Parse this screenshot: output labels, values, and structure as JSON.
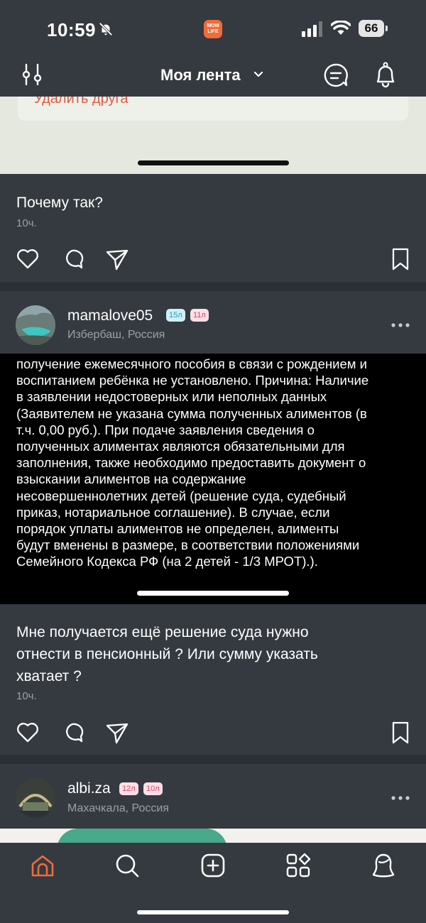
{
  "status_bar": {
    "time": "10:59",
    "app_badge": "MOM LIFE",
    "battery": "66"
  },
  "header": {
    "title": "Моя лента"
  },
  "post1": {
    "media_partial_text": "Удалить друга",
    "caption": "Почему так?",
    "time": "10ч."
  },
  "post2": {
    "username": "mamalove05",
    "badges": [
      "15л",
      "11л"
    ],
    "location": "Избербаш, Россия",
    "image_lines": [
      "получение ежемесячного пособия в связи с рождением и",
      "воспитанием ребёнка не установлено. Причина: Наличие",
      "в заявлении недостоверных или неполных данных",
      "(Заявителем не указана сумма полученных алиментов (в",
      "т.ч. 0,00 руб.). При подаче заявления сведения о",
      "полученных алиментах являются обязательными для",
      "заполнения, также необходимо предоставить документ о",
      "взыскании алиментов на содержание",
      "несовершеннолетних детей (решение суда, судебный",
      "приказ, нотариальное соглашение). В случае, если",
      "порядок уплаты алиментов не определен, алименты",
      "будут вменены в размере, в соответствии положениями",
      "Семейного Кодекса РФ (на 2 детей - 1/3 МРОТ).)."
    ],
    "caption_lines": [
      "Мне получается ещё решение суда нужно",
      "отнести в пенсионный ? Или сумму указать",
      "хватает ?"
    ],
    "time": "10ч."
  },
  "post3": {
    "username": "albi.za",
    "badges": [
      "12л",
      "10л"
    ],
    "location": "Махачкала, Россия"
  },
  "colors": {
    "background": "#343a40",
    "accent": "#f26b3a",
    "badge_blue": "#cdf1f8",
    "badge_pink": "#fde0e6"
  },
  "icons": [
    "bell-slash-icon",
    "signal-icon",
    "wifi-icon",
    "filter-icon",
    "chevron-down-icon",
    "chat-icon",
    "notifications-icon",
    "heart-icon",
    "comment-icon",
    "share-icon",
    "bookmark-icon",
    "more-icon",
    "home-icon",
    "search-icon",
    "add-icon",
    "services-icon",
    "profile-icon"
  ]
}
